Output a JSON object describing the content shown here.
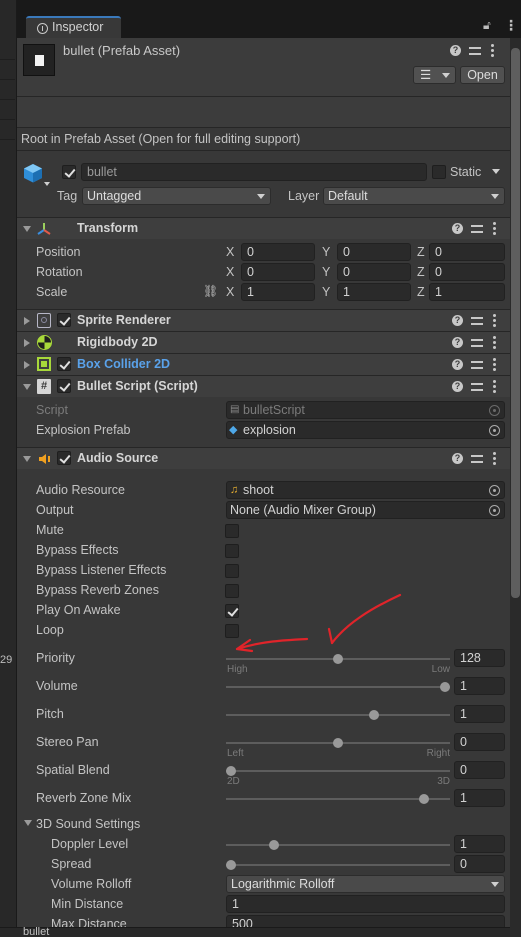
{
  "tab": {
    "label": "Inspector"
  },
  "header": {
    "title": "bullet (Prefab Asset)",
    "open_label": "Open",
    "notice": "Root in Prefab Asset (Open for full editing support)"
  },
  "gameobject": {
    "name": "bullet",
    "static_label": "Static",
    "tag_label": "Tag",
    "tag_value": "Untagged",
    "layer_label": "Layer",
    "layer_value": "Default"
  },
  "transform": {
    "title": "Transform",
    "rows": [
      {
        "label": "Position",
        "x": "0",
        "y": "0",
        "z": "0"
      },
      {
        "label": "Rotation",
        "x": "0",
        "y": "0",
        "z": "0"
      },
      {
        "label": "Scale",
        "x": "1",
        "y": "1",
        "z": "1"
      }
    ],
    "axis": {
      "x": "X",
      "y": "Y",
      "z": "Z"
    }
  },
  "components": {
    "sprite_renderer": "Sprite Renderer",
    "rigidbody": "Rigidbody 2D",
    "box_collider": "Box Collider 2D",
    "bullet_script": "Bullet Script (Script)"
  },
  "bullet_script": {
    "script_label": "Script",
    "script_value": "bulletScript",
    "explosion_label": "Explosion Prefab",
    "explosion_value": "explosion"
  },
  "audio": {
    "title": "Audio Source",
    "resource_label": "Audio Resource",
    "resource_value": "shoot",
    "output_label": "Output",
    "output_value": "None (Audio Mixer Group)",
    "toggles": [
      {
        "label": "Mute",
        "checked": false
      },
      {
        "label": "Bypass Effects",
        "checked": false
      },
      {
        "label": "Bypass Listener Effects",
        "checked": false
      },
      {
        "label": "Bypass Reverb Zones",
        "checked": false
      },
      {
        "label": "Play On Awake",
        "checked": true
      },
      {
        "label": "Loop",
        "checked": false
      }
    ],
    "priority": {
      "label": "Priority",
      "value": "128",
      "min_label": "High",
      "max_label": "Low",
      "fraction": 0.5
    },
    "volume": {
      "label": "Volume",
      "value": "1",
      "fraction": 1.0
    },
    "pitch": {
      "label": "Pitch",
      "value": "1",
      "fraction": 0.67
    },
    "stereo_pan": {
      "label": "Stereo Pan",
      "value": "0",
      "min_label": "Left",
      "max_label": "Right",
      "fraction": 0.5
    },
    "spatial_blend": {
      "label": "Spatial Blend",
      "value": "0",
      "min_label": "2D",
      "max_label": "3D",
      "fraction": 0.0
    },
    "reverb_mix": {
      "label": "Reverb Zone Mix",
      "value": "1",
      "fraction": 0.9
    },
    "sound3d_title": "3D Sound Settings",
    "doppler": {
      "label": "Doppler Level",
      "value": "1",
      "fraction": 0.2
    },
    "spread": {
      "label": "Spread",
      "value": "0",
      "fraction": 0.0
    },
    "rolloff_label": "Volume Rolloff",
    "rolloff_value": "Logarithmic Rolloff",
    "min_distance_label": "Min Distance",
    "min_distance_value": "1",
    "max_distance_label": "Max Distance",
    "max_distance_value": "500"
  },
  "left_panel": {
    "partial_text": "29"
  },
  "footer": {
    "label": "bullet"
  },
  "annotation_color": "#e0242a"
}
